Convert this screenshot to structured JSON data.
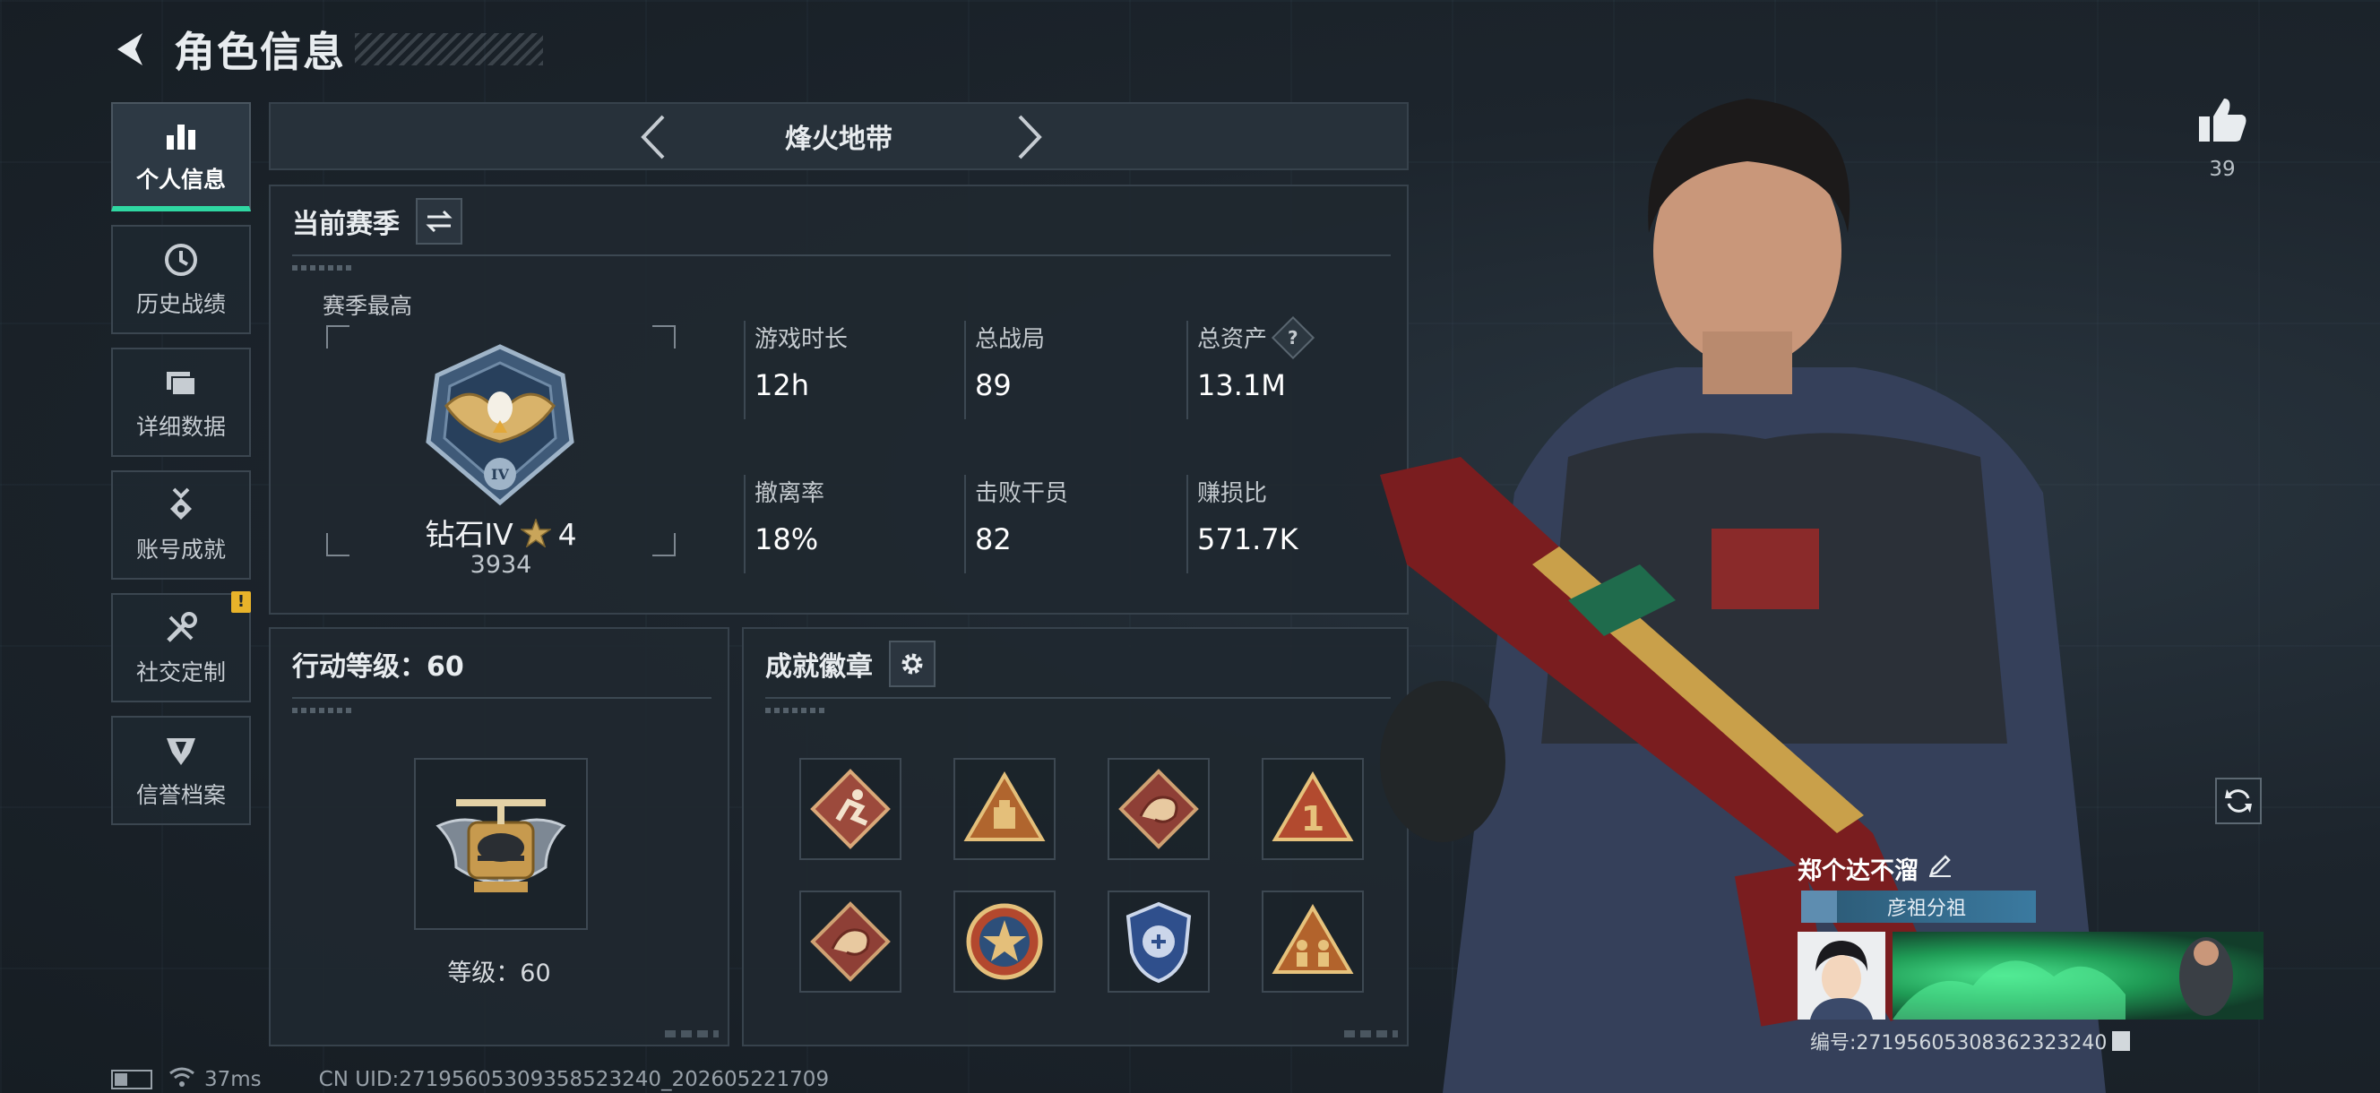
{
  "header": {
    "title": "角色信息"
  },
  "sidebar": {
    "items": [
      {
        "label": "个人信息",
        "icon": "bar-chart-icon",
        "active": true
      },
      {
        "label": "历史战绩",
        "icon": "clock-icon",
        "active": false
      },
      {
        "label": "详细数据",
        "icon": "folder-icon",
        "active": false
      },
      {
        "label": "账号成就",
        "icon": "medal-icon",
        "active": false
      },
      {
        "label": "社交定制",
        "icon": "wrench-icon",
        "active": false,
        "alert": "!"
      },
      {
        "label": "信誉档案",
        "icon": "shield-emblem-icon",
        "active": false
      }
    ]
  },
  "mode": {
    "title": "烽火地带"
  },
  "season": {
    "title": "当前赛季",
    "best_label": "赛季最高",
    "rank_name": "钻石IV",
    "rank_stars": "4",
    "rank_score": "3934",
    "stats": [
      {
        "label": "游戏时长",
        "value": "12h"
      },
      {
        "label": "总战局",
        "value": "89"
      },
      {
        "label": "总资产",
        "value": "13.1M",
        "help": "?"
      },
      {
        "label": "撤离率",
        "value": "18%"
      },
      {
        "label": "击败干员",
        "value": "82"
      },
      {
        "label": "赚损比",
        "value": "571.7K"
      }
    ]
  },
  "action_level": {
    "title": "行动等级：60",
    "level_text": "等级：60"
  },
  "badges": {
    "title": "成就徽章",
    "items": [
      "runner-badge-icon",
      "supply-badge-icon",
      "dragon-badge-icon",
      "first-badge-icon",
      "dragon-badge-icon",
      "star-badge-icon",
      "police-badge-icon",
      "squad-badge-icon"
    ]
  },
  "status": {
    "ping": "37ms",
    "uid": "CN UID:27195605309358523240_202605221709"
  },
  "character": {
    "likes": "39"
  },
  "player": {
    "name": "郑个达不溜",
    "clan": "彦祖分祖",
    "id": "编号:27195605308362323240"
  },
  "colors": {
    "accent": "#2fd7a2",
    "alert": "#e8b32a"
  }
}
